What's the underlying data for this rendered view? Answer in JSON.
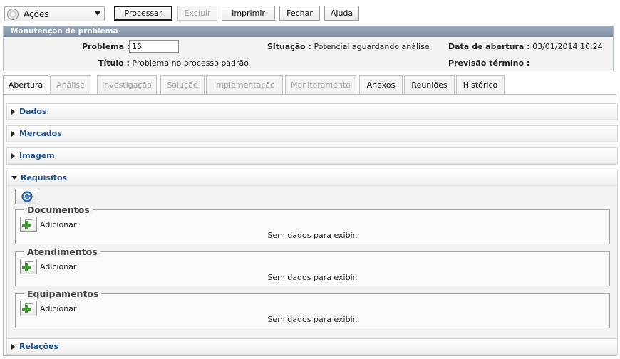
{
  "toolbar": {
    "actions_label": "Ações",
    "process_label": "Processar",
    "delete_label": "Excluir",
    "print_label": "Imprimir",
    "close_label": "Fechar",
    "help_label": "Ajuda"
  },
  "header": {
    "title": "Manutenção de problema",
    "problem_label": "Problema :",
    "problem_value": "16",
    "status_label": "Situação :",
    "status_value": "Potencial aguardando análise",
    "opening_label": "Data de abertura :",
    "opening_value": "03/01/2014 10:24",
    "title_label": "Título :",
    "title_value": "Problema no processo padrão",
    "end_label": "Previsão término :"
  },
  "tabs": [
    {
      "label": "Abertura"
    },
    {
      "label": "Análise"
    },
    {
      "label": "Investigação"
    },
    {
      "label": "Solução"
    },
    {
      "label": "Implementação"
    },
    {
      "label": "Monitoramento"
    },
    {
      "label": "Anexos"
    },
    {
      "label": "Reuniões"
    },
    {
      "label": "Histórico"
    }
  ],
  "sections": {
    "dados": "Dados",
    "mercados": "Mercados",
    "imagem": "Imagem",
    "requisitos": "Requisitos",
    "relacoes": "Relações"
  },
  "requisitos": {
    "groups": [
      {
        "title": "Documentos",
        "add_label": "Adicionar",
        "empty": "Sem dados para exibir."
      },
      {
        "title": "Atendimentos",
        "add_label": "Adicionar",
        "empty": "Sem dados para exibir."
      },
      {
        "title": "Equipamentos",
        "add_label": "Adicionar",
        "empty": "Sem dados para exibir."
      }
    ]
  },
  "icons": {
    "actions": "gear-icon",
    "refresh": "refresh-icon",
    "add": "add-document-icon"
  }
}
